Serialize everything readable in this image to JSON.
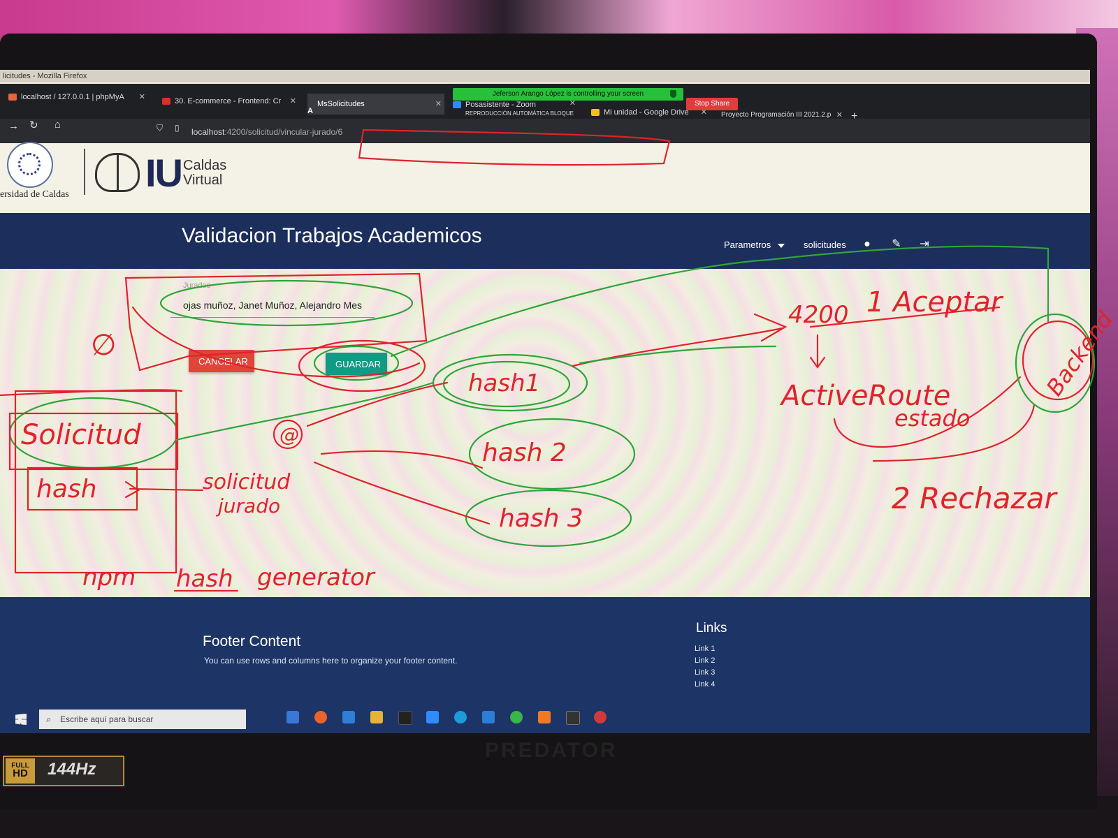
{
  "window": {
    "title": "licitudes - Mozilla Firefox"
  },
  "zoom": {
    "banner_text": "Jeferson Arango López is controlling your screen",
    "stop_share_label": "Stop Share"
  },
  "tabs": [
    {
      "label": "localhost / 127.0.0.1 | phpMyA",
      "active": false,
      "icon_color": "#e8643a"
    },
    {
      "label": "30. E-commerce - Frontend: Cr",
      "active": false,
      "icon_color": "#e02b2b"
    },
    {
      "label": "MsSolicitudes",
      "active": true,
      "icon_color": "#ffffff"
    },
    {
      "label": "Posasistente - Zoom",
      "sublabel": "REPRODUCCIÓN AUTOMÁTICA BLOQUE",
      "active": false,
      "icon_color": "#2d8cff"
    },
    {
      "label": "Mi unidad - Google Drive",
      "active": false,
      "icon_color": "#f4c20d"
    },
    {
      "label": "Proyecto Programación III 2021.2.p",
      "active": false,
      "icon_color": "#888888"
    }
  ],
  "address": {
    "host": "localhost",
    "path": ":4200/solicitud/vincular-jurado/6"
  },
  "site": {
    "university_name": "ersidad de Caldas",
    "brand_letters": "IU",
    "brand_name_line1": "Caldas",
    "brand_name_line2": "Virtual"
  },
  "navbar": {
    "title": "Validacion Trabajos Academicos",
    "parametros_label": "Parametros",
    "solicitudes_label": "solicitudes"
  },
  "form": {
    "jurado_label": "Jurados",
    "jurado_value": "ojas muñoz, Janet Muñoz, Alejandro Mesa",
    "cancel_label": "CANCELAR",
    "save_label": "GUARDAR"
  },
  "footer": {
    "title": "Footer Content",
    "text": "You can use rows and columns here to organize your footer content.",
    "links_title": "Links",
    "links": [
      "Link 1",
      "Link 2",
      "Link 3",
      "Link 4"
    ]
  },
  "taskbar": {
    "search_placeholder": "Escribe aquí para buscar"
  },
  "bezel": {
    "badge_line1": "FULL",
    "badge_line2": "HD",
    "badge_rate": "144Hz",
    "brand": "PREDATOR"
  },
  "annotations": {
    "colors": {
      "red": "#e0232a",
      "green": "#2fa53a"
    },
    "texts": {
      "solicitud": "Solicitud",
      "hash": "hash",
      "solicitud_jurado_1": "solicitud",
      "solicitud_jurado_2": "jurado",
      "npm": "npm",
      "hash_gen_1": "hash",
      "hash_gen_2": "generator",
      "hash1": "hash1",
      "hash2": "hash 2",
      "hash3": "hash 3",
      "port": "4200",
      "aceptar": "1 Aceptar",
      "active_route": "ActiveRoute",
      "estado": "estado",
      "backend": "Backend",
      "rechazar": "2 Rechazar",
      "empty_set": "∅",
      "at": "@"
    }
  }
}
